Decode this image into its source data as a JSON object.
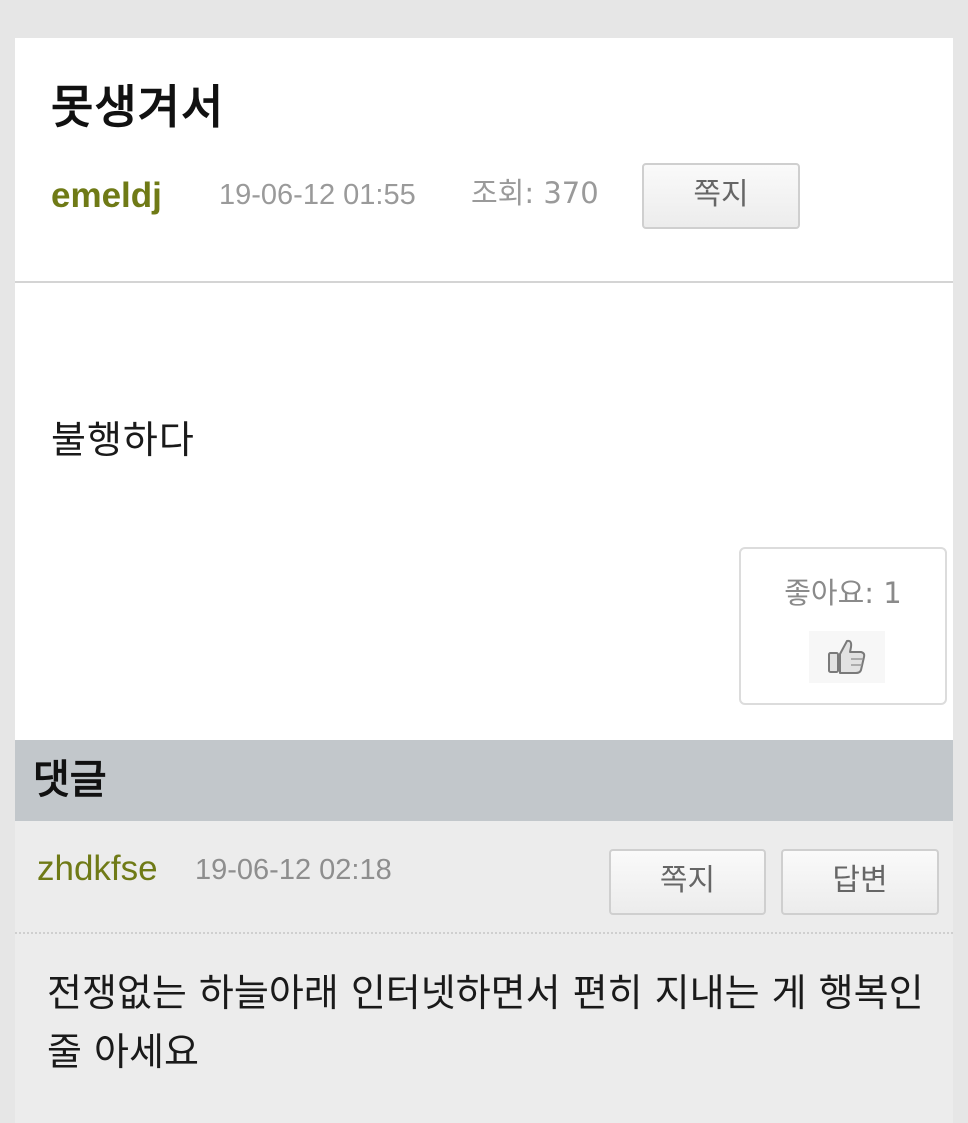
{
  "post": {
    "title": "못생겨서",
    "author": "emeldj",
    "date": "19-06-12 01:55",
    "views_text": "조회: 370",
    "message_button": "쪽지",
    "body": "불행하다",
    "like_label": "좋아요: 1",
    "like_icon": "thumbs-up-icon"
  },
  "comments": {
    "heading": "댓글",
    "items": [
      {
        "author": "zhdkfse",
        "date": "19-06-12 02:18",
        "message_button": "쪽지",
        "reply_button": "답변",
        "text": "전쟁없는 하늘아래 인터넷하면서 편히 지내는 게 행복인줄 아세요"
      }
    ]
  },
  "colors": {
    "author": "#6f7a16",
    "comment_header_bg": "#c2c7cb",
    "page_bg": "#e6e6e6"
  }
}
